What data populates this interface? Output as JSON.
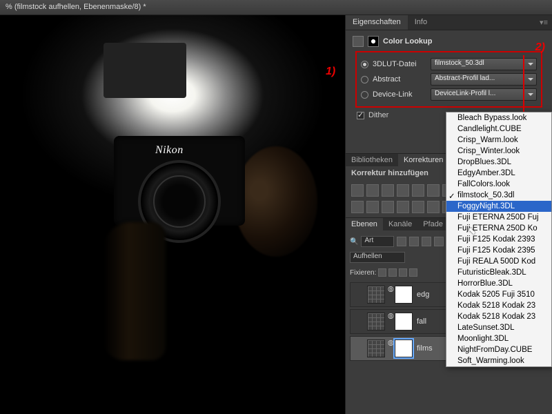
{
  "titlebar": "% (filmstock aufhellen, Ebenenmaske/8) *",
  "properties": {
    "tab_props": "Eigenschaften",
    "tab_info": "Info",
    "title": "Color Lookup",
    "rows": {
      "r1_label": "3DLUT-Datei",
      "r1_value": "filmstock_50.3dl",
      "r2_label": "Abstract",
      "r2_value": "Abstract-Profil lad...",
      "r3_label": "Device-Link",
      "r3_value": "DeviceLink-Profil l...",
      "dither": "Dither"
    }
  },
  "annotations": {
    "one": "1)",
    "two": "2)"
  },
  "lut_dropdown": {
    "items": [
      "Bleach Bypass.look",
      "Candlelight.CUBE",
      "Crisp_Warm.look",
      "Crisp_Winter.look",
      "DropBlues.3DL",
      "EdgyAmber.3DL",
      "FallColors.look",
      "filmstock_50.3dl",
      "FoggyNight.3DL",
      "Fuji ETERNA 250D Fuj",
      "Fuji ETERNA 250D Ko",
      "Fuji F125 Kodak 2393",
      "Fuji F125 Kodak 2395",
      "Fuji REALA 500D Kod",
      "FuturisticBleak.3DL",
      "HorrorBlue.3DL",
      "Kodak 5205 Fuji 3510",
      "Kodak 5218 Kodak 23",
      "Kodak 5218 Kodak 23",
      "LateSunset.3DL",
      "Moonlight.3DL",
      "NightFromDay.CUBE",
      "Soft_Warming.look"
    ],
    "checked_index": 7,
    "selected_index": 8
  },
  "libraries": {
    "tab_bibl": "Bibliotheken",
    "tab_korr": "Korrekturen",
    "add_label": "Korrektur hinzufügen"
  },
  "layers_panel": {
    "tab_ebenen": "Ebenen",
    "tab_kanale": "Kanäle",
    "tab_pfade": "Pfade",
    "filter_label": "Art",
    "aufhellen": "Aufhellen",
    "fixieren": "Fixieren:",
    "layers": [
      {
        "name": "edg"
      },
      {
        "name": "fall"
      },
      {
        "name": "films"
      }
    ]
  }
}
